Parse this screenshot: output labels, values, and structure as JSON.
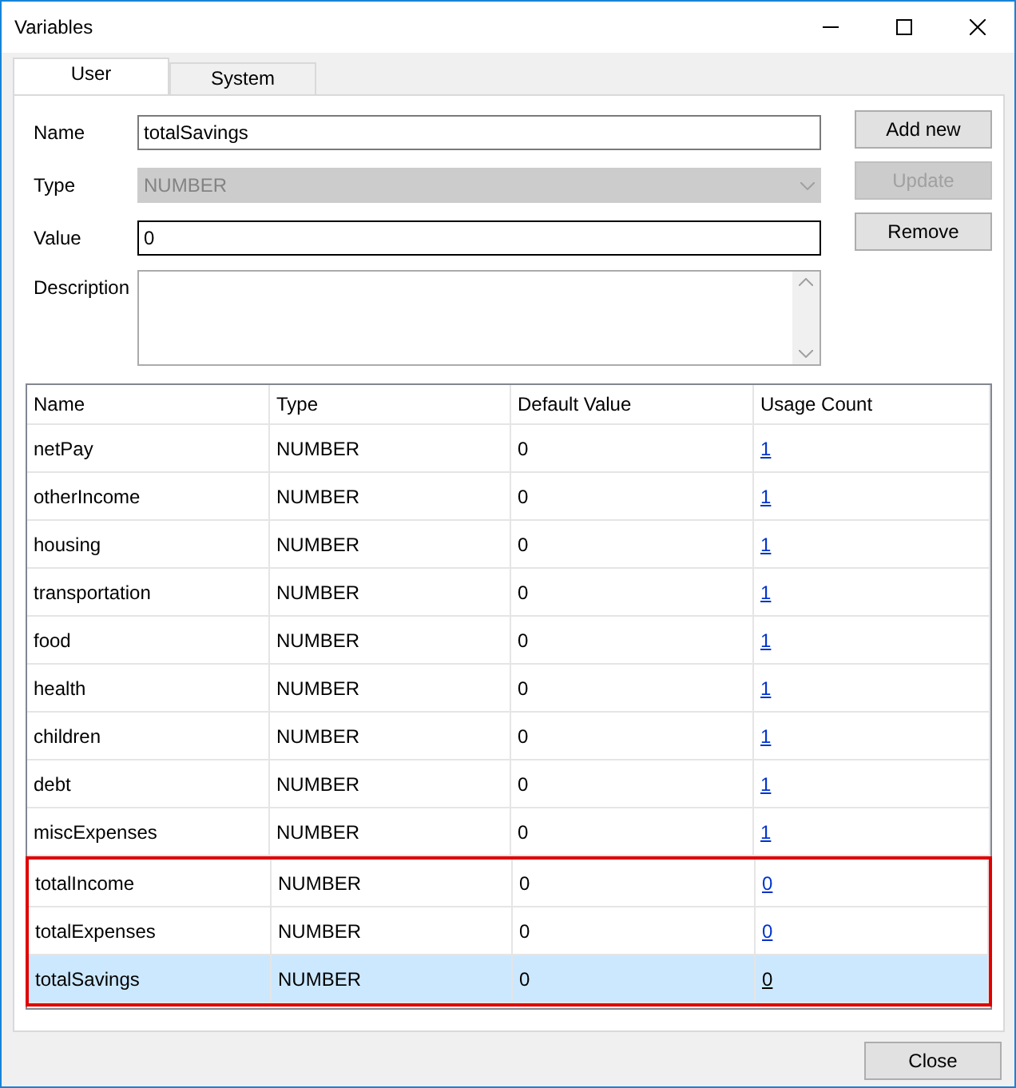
{
  "window": {
    "title": "Variables"
  },
  "tabs": [
    {
      "label": "User",
      "selected": true
    },
    {
      "label": "System",
      "selected": false
    }
  ],
  "form": {
    "name_label": "Name",
    "name_value": "totalSavings",
    "type_label": "Type",
    "type_value": "NUMBER",
    "type_disabled": true,
    "value_label": "Value",
    "value_value": "0",
    "description_label": "Description"
  },
  "buttons": [
    {
      "label": "Add new",
      "disabled": false
    },
    {
      "label": "Update",
      "disabled": true
    },
    {
      "label": "Remove",
      "disabled": false
    }
  ],
  "table": {
    "columns": [
      "Name",
      "Type",
      "Default Value",
      "Usage Count"
    ],
    "rows": [
      {
        "name": "netPay",
        "type": "NUMBER",
        "default": "0",
        "usage": "1",
        "selected": false,
        "highlighted": false
      },
      {
        "name": "otherIncome",
        "type": "NUMBER",
        "default": "0",
        "usage": "1",
        "selected": false,
        "highlighted": false
      },
      {
        "name": "housing",
        "type": "NUMBER",
        "default": "0",
        "usage": "1",
        "selected": false,
        "highlighted": false
      },
      {
        "name": "transportation",
        "type": "NUMBER",
        "default": "0",
        "usage": "1",
        "selected": false,
        "highlighted": false
      },
      {
        "name": "food",
        "type": "NUMBER",
        "default": "0",
        "usage": "1",
        "selected": false,
        "highlighted": false
      },
      {
        "name": "health",
        "type": "NUMBER",
        "default": "0",
        "usage": "1",
        "selected": false,
        "highlighted": false
      },
      {
        "name": "children",
        "type": "NUMBER",
        "default": "0",
        "usage": "1",
        "selected": false,
        "highlighted": false
      },
      {
        "name": "debt",
        "type": "NUMBER",
        "default": "0",
        "usage": "1",
        "selected": false,
        "highlighted": false
      },
      {
        "name": "miscExpenses",
        "type": "NUMBER",
        "default": "0",
        "usage": "1",
        "selected": false,
        "highlighted": false
      },
      {
        "name": "totalIncome",
        "type": "NUMBER",
        "default": "0",
        "usage": "0",
        "selected": false,
        "highlighted": true
      },
      {
        "name": "totalExpenses",
        "type": "NUMBER",
        "default": "0",
        "usage": "0",
        "selected": false,
        "highlighted": true
      },
      {
        "name": "totalSavings",
        "type": "NUMBER",
        "default": "0",
        "usage": "0",
        "selected": true,
        "highlighted": true
      }
    ]
  },
  "close_button": "Close"
}
